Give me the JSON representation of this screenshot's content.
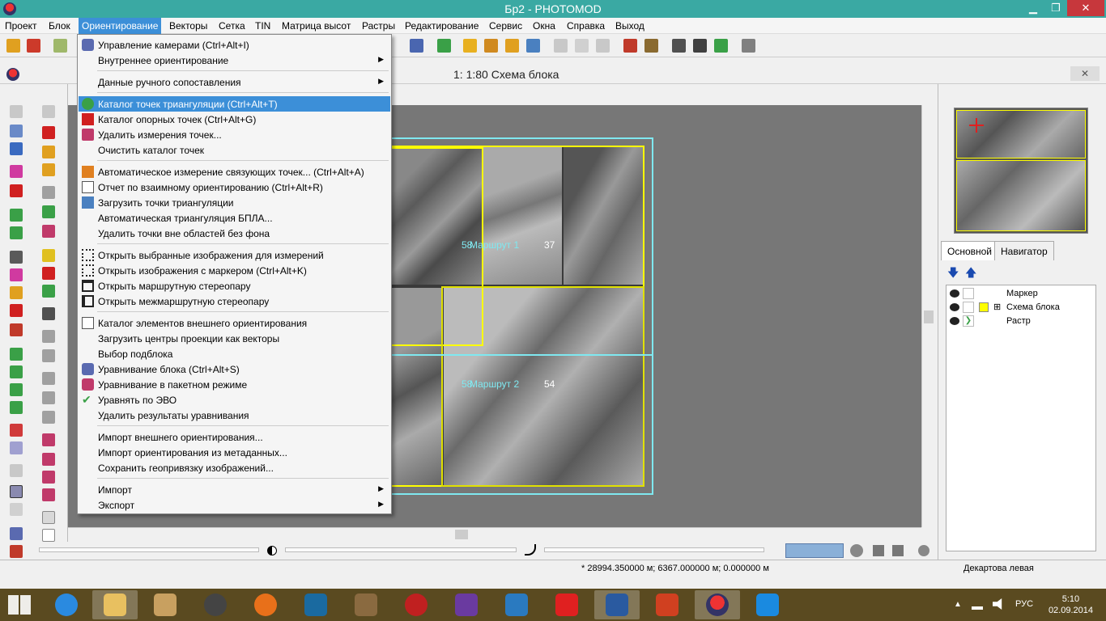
{
  "window": {
    "title": "Бр2 - PHOTOMOD",
    "min": "▁",
    "max": "❐",
    "close": "✕"
  },
  "menubar": [
    "Проект",
    "Блок",
    "Ориентирование",
    "Векторы",
    "Сетка",
    "TIN",
    "Матрица высот",
    "Растры",
    "Редактирование",
    "Сервис",
    "Окна",
    "Справка",
    "Выход"
  ],
  "subwindow": {
    "title": "1: 1:80 Схема блока",
    "close": "✕"
  },
  "menu": {
    "items": [
      {
        "label": "Управление камерами (Ctrl+Alt+I)"
      },
      {
        "label": "Внутреннее ориентирование",
        "submenu": "▶"
      },
      {
        "label": "Данные ручного сопоставления",
        "submenu": "▶"
      },
      {
        "label": "Каталог точек триангуляции (Ctrl+Alt+T)"
      },
      {
        "label": "Каталог опорных точек (Ctrl+Alt+G)"
      },
      {
        "label": "Удалить измерения точек..."
      },
      {
        "label": "Очистить каталог точек"
      },
      {
        "label": "Автоматическое измерение связующих точек... (Ctrl+Alt+A)"
      },
      {
        "label": "Отчет по взаимному ориентированию (Ctrl+Alt+R)"
      },
      {
        "label": "Загрузить точки триангуляции"
      },
      {
        "label": "Автоматическая триангуляция БПЛА..."
      },
      {
        "label": "Удалить точки вне областей без фона"
      },
      {
        "label": "Открыть выбранные изображения для измерений"
      },
      {
        "label": "Открыть изображения с маркером (Ctrl+Alt+K)"
      },
      {
        "label": "Открыть маршрутную стереопару"
      },
      {
        "label": "Открыть межмаршрутную стереопару"
      },
      {
        "label": "Каталог элементов внешнего ориентирования"
      },
      {
        "label": "Загрузить центры проекции как векторы"
      },
      {
        "label": "Выбор подблока"
      },
      {
        "label": "Уравнивание блока (Ctrl+Alt+S)"
      },
      {
        "label": "Уравнивание в пакетном режиме"
      },
      {
        "label": "Уравнять по ЭВО"
      },
      {
        "label": "Удалить результаты уравнивания"
      },
      {
        "label": "Импорт внешнего ориентирования..."
      },
      {
        "label": "Импорт ориентирования из метаданных..."
      },
      {
        "label": "Сохранить геопривязку изображений..."
      },
      {
        "label": "Импорт",
        "submenu": "▶"
      },
      {
        "label": "Экспорт",
        "submenu": "▶"
      }
    ]
  },
  "canvas": {
    "route1": "Маршрут 1",
    "route1_num": "37",
    "route2": "Маршрут 2",
    "route2_num": "54",
    "overlap1": "58",
    "overlap2": "58"
  },
  "statusbar": {
    "coords": "* 28994.350000 м; 6367.000000 м; 0.000000 м",
    "projection": "Декартова левая"
  },
  "rightpanel": {
    "tabs": [
      "Основной",
      "Навигатор"
    ],
    "layers": [
      {
        "name": "Маркер"
      },
      {
        "name": "Схема блока",
        "expand": "⊞"
      },
      {
        "name": "Растр"
      }
    ]
  },
  "tray": {
    "lang": "РУС",
    "time": "5:10",
    "date": "02.09.2014",
    "chevron": "▲"
  },
  "colors": {
    "titlebar": "#3aa9a3",
    "highlight": "#3c8fd8",
    "route_box": "#ffff00",
    "block_outline": "#7fe8f0",
    "taskbar": "#5a4a20"
  }
}
